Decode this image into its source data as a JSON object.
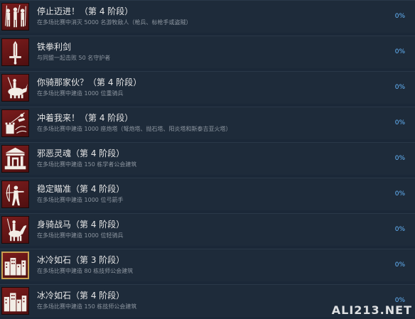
{
  "achievements": [
    {
      "title": "停止迈进！（第 4 阶段）",
      "desc": "在多场比赛中消灭 5000 名游牧敌人（枪兵、标枪手或盗贼）",
      "pct": "0%",
      "icon": "warriors-icon",
      "gold": false
    },
    {
      "title": "铁拳利剑",
      "desc": "与同盟一起击败 50 名守护者",
      "pct": "0%",
      "icon": "sword-icon",
      "gold": false
    },
    {
      "title": "你骑那家伙？（第 4 阶段）",
      "desc": "在多场比赛中建造 1000 位重骑兵",
      "pct": "0%",
      "icon": "rhino-rider-icon",
      "gold": false
    },
    {
      "title": "冲着我来！（第 4 阶段）",
      "desc": "在多场比赛中建造 1000 座炮塔（弩炮塔、抛石塔、阳炎塔和斯泰吉亚火塔）",
      "pct": "0%",
      "icon": "tower-icon",
      "gold": false
    },
    {
      "title": "邪恶灵魂（第 4 阶段）",
      "desc": "在多场比赛中建造 150 栋学者公会建筑",
      "pct": "0%",
      "icon": "temple-icon",
      "gold": false
    },
    {
      "title": "稳定瞄准（第 4 阶段）",
      "desc": "在多场比赛中建造 1000 位弓箭手",
      "pct": "0%",
      "icon": "archer-icon",
      "gold": false
    },
    {
      "title": "身骑战马（第 4 阶段）",
      "desc": "在多场比赛中建造 1000 位轻骑兵",
      "pct": "0%",
      "icon": "horseman-icon",
      "gold": false
    },
    {
      "title": "冰冷如石（第 3 阶段）",
      "desc": "在多场比赛中建造 80 栋技师公会建筑",
      "pct": "0%",
      "icon": "city-icon",
      "gold": true
    },
    {
      "title": "冰冷如石（第 4 阶段）",
      "desc": "在多场比赛中建造 150 栋技师公会建筑",
      "pct": "0%",
      "icon": "city-icon",
      "gold": false
    }
  ],
  "watermark": "ALI213.NET"
}
